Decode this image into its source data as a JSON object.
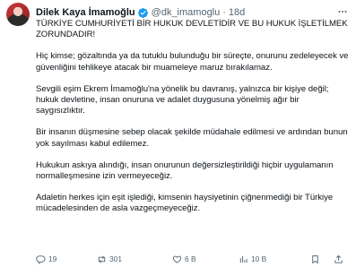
{
  "author": {
    "name": "Dilek Kaya İmamoğlu",
    "handle": "@dk_imamoglu",
    "separator": "·",
    "time": "18d",
    "verified_color": "#1d9bf0"
  },
  "tweet": {
    "paragraphs": [
      "TÜRKİYE CUMHURİYETİ BİR HUKUK DEVLETİDİR VE BU HUKUK İŞLETİLMEK ZORUNDADIR!",
      "Hiç kimse; gözaltında ya da tutuklu bulunduğu bir süreçte, onurunu zedeleyecek ve güvenliğini tehlikeye atacak bir muameleye maruz bırakılamaz.",
      "Sevgili eşim Ekrem İmamoğlu'na yönelik bu davranış, yalnızca bir kişiye değil; hukuk devletine, insan onuruna ve adalet duygusuna yönelmiş ağır bir saygısızlıktır.",
      "Bir insanın düşmesine sebep olacak şekilde müdahale edilmesi ve ardından bunun yok sayılması kabul edilemez.",
      "Hukukun askıya alındığı, insan onurunun değersizleştirildiği hiçbir uygulamanın normalleşmesine izin vermeyeceğiz.",
      "Adaletin herkes için eşit işlediği, kimsenin haysiyetinin çiğnenmediği bir Türkiye mücadelesinden de asla vazgeçmeyeceğiz."
    ]
  },
  "actions": {
    "replies": "19",
    "reposts": "301",
    "likes": "6 B",
    "views": "10 B"
  },
  "icons": {
    "more": "more-icon",
    "reply": "reply-icon",
    "repost": "repost-icon",
    "like": "heart-icon",
    "views": "views-icon",
    "bookmark": "bookmark-icon",
    "share": "share-icon"
  }
}
